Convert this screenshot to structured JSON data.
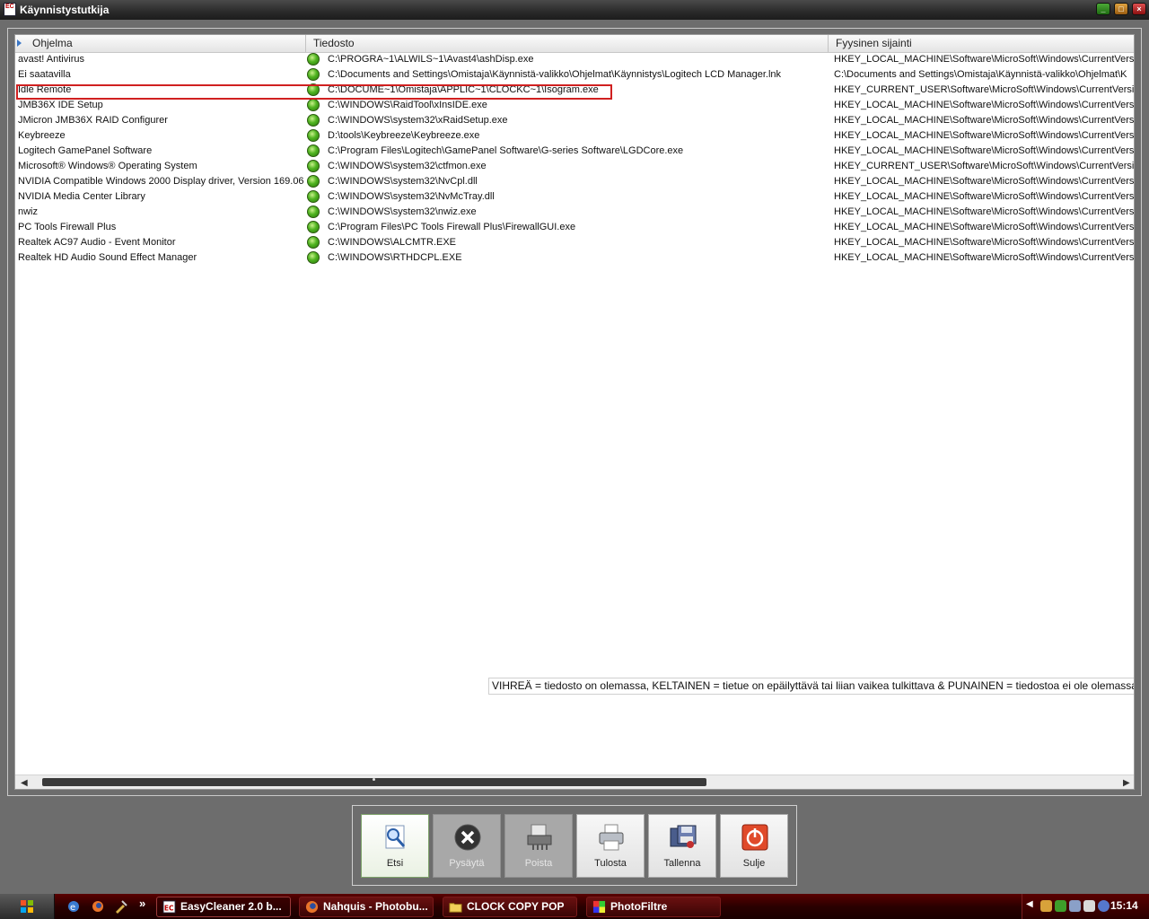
{
  "window": {
    "title": "Käynnistystutkija"
  },
  "columns": [
    "Ohjelma",
    "Tiedosto",
    "Fyysinen sijainti"
  ],
  "rows": [
    {
      "program": "avast! Antivirus",
      "file": "C:\\PROGRA~1\\ALWILS~1\\Avast4\\ashDisp.exe",
      "location": "HKEY_LOCAL_MACHINE\\Software\\MicroSoft\\Windows\\CurrentVersi"
    },
    {
      "program": "Ei saatavilla",
      "file": "C:\\Documents and Settings\\Omistaja\\Käynnistä-valikko\\Ohjelmat\\Käynnistys\\Logitech LCD Manager.lnk",
      "location": "C:\\Documents and Settings\\Omistaja\\Käynnistä-valikko\\Ohjelmat\\K"
    },
    {
      "program": "Idle Remote",
      "file": "C:\\DOCUME~1\\Omistaja\\APPLIC~1\\CLOCKC~1\\Isogram.exe",
      "location": "HKEY_CURRENT_USER\\Software\\MicroSoft\\Windows\\CurrentVersi"
    },
    {
      "program": "JMB36X IDE Setup",
      "file": "C:\\WINDOWS\\RaidTool\\xInsIDE.exe",
      "location": "HKEY_LOCAL_MACHINE\\Software\\MicroSoft\\Windows\\CurrentVersi"
    },
    {
      "program": "JMicron JMB36X RAID Configurer",
      "file": "C:\\WINDOWS\\system32\\xRaidSetup.exe",
      "location": "HKEY_LOCAL_MACHINE\\Software\\MicroSoft\\Windows\\CurrentVersi"
    },
    {
      "program": "Keybreeze",
      "file": "D:\\tools\\Keybreeze\\Keybreeze.exe",
      "location": "HKEY_LOCAL_MACHINE\\Software\\MicroSoft\\Windows\\CurrentVersi"
    },
    {
      "program": "Logitech GamePanel Software",
      "file": "C:\\Program Files\\Logitech\\GamePanel Software\\G-series Software\\LGDCore.exe",
      "location": "HKEY_LOCAL_MACHINE\\Software\\MicroSoft\\Windows\\CurrentVersi"
    },
    {
      "program": "Microsoft® Windows® Operating System",
      "file": "C:\\WINDOWS\\system32\\ctfmon.exe",
      "location": "HKEY_CURRENT_USER\\Software\\MicroSoft\\Windows\\CurrentVersi"
    },
    {
      "program": "NVIDIA Compatible Windows 2000 Display driver, Version 169.06",
      "file": "C:\\WINDOWS\\system32\\NvCpl.dll",
      "location": "HKEY_LOCAL_MACHINE\\Software\\MicroSoft\\Windows\\CurrentVersi"
    },
    {
      "program": "NVIDIA Media Center Library",
      "file": "C:\\WINDOWS\\system32\\NvMcTray.dll",
      "location": "HKEY_LOCAL_MACHINE\\Software\\MicroSoft\\Windows\\CurrentVersi"
    },
    {
      "program": "nwiz",
      "file": "C:\\WINDOWS\\system32\\nwiz.exe",
      "location": "HKEY_LOCAL_MACHINE\\Software\\MicroSoft\\Windows\\CurrentVersi"
    },
    {
      "program": "PC Tools Firewall Plus",
      "file": "C:\\Program Files\\PC Tools Firewall Plus\\FirewallGUI.exe",
      "location": "HKEY_LOCAL_MACHINE\\Software\\MicroSoft\\Windows\\CurrentVersi"
    },
    {
      "program": "Realtek AC97 Audio - Event Monitor",
      "file": "C:\\WINDOWS\\ALCMTR.EXE",
      "location": "HKEY_LOCAL_MACHINE\\Software\\MicroSoft\\Windows\\CurrentVersi"
    },
    {
      "program": "Realtek HD Audio Sound Effect Manager",
      "file": "C:\\WINDOWS\\RTHDCPL.EXE",
      "location": "HKEY_LOCAL_MACHINE\\Software\\MicroSoft\\Windows\\CurrentVersi"
    }
  ],
  "legend_hint": "VIHREÄ = tiedosto on olemassa, KELTAINEN = tietue on epäilyttävä tai liian vaikea tulkittava & PUNAINEN = tiedostoa ei ole olemassa",
  "toolbar": {
    "search": "Etsi",
    "stop": "Pysäytä",
    "delete": "Poista",
    "print": "Tulosta",
    "save": "Tallenna",
    "close": "Sulje"
  },
  "taskbar": {
    "items": [
      "EasyCleaner 2.0 b...",
      "Nahquis - Photobu...",
      "CLOCK COPY POP",
      "PhotoFiltre"
    ],
    "overflow": "»",
    "clock": "15:14"
  },
  "colors": {
    "status_green": "#4fb320",
    "highlight_red": "#d02020",
    "taskbar": "#2a0000"
  }
}
